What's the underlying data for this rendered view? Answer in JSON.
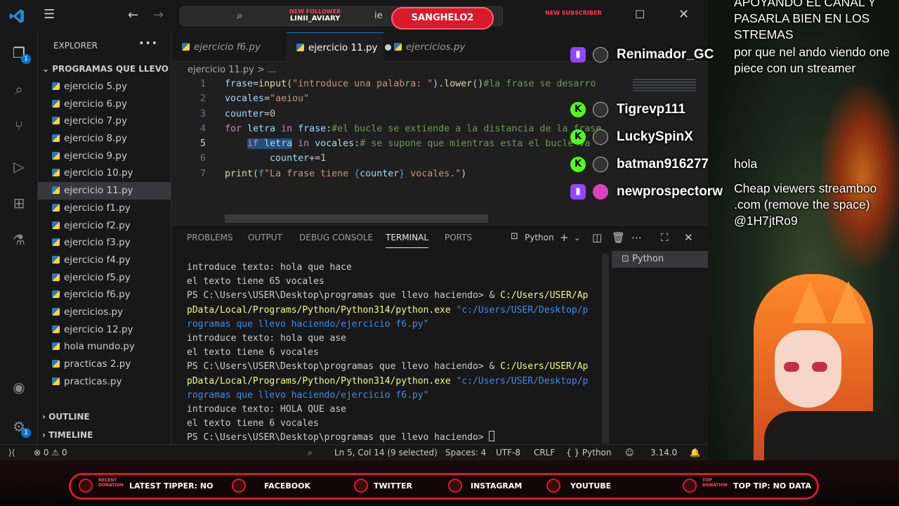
{
  "title_bar": {
    "command_center_placeholder": "",
    "overlapped_text": "ie"
  },
  "sidebar": {
    "header": "EXPLORER",
    "folder": "PROGRAMAS QUE LLEVO ...",
    "files": [
      {
        "label": "ejercicio 5.py"
      },
      {
        "label": "ejercicio 6.py"
      },
      {
        "label": "ejercicio 7.py"
      },
      {
        "label": "ejercicio 8.py"
      },
      {
        "label": "ejercicio 9.py"
      },
      {
        "label": "ejercicio 10.py"
      },
      {
        "label": "ejercicio 11.py",
        "active": true
      },
      {
        "label": "ejercicio f1.py"
      },
      {
        "label": "ejercicio f2.py"
      },
      {
        "label": "ejercicio f3.py"
      },
      {
        "label": "ejercicio f4.py"
      },
      {
        "label": "ejercicio f5.py"
      },
      {
        "label": "ejercicio f6.py"
      },
      {
        "label": "ejercicios.py"
      },
      {
        "label": "ejercicio 12.py"
      },
      {
        "label": "hola mundo.py"
      },
      {
        "label": "practicas 2.py"
      },
      {
        "label": "practicas.py"
      }
    ],
    "outline": "OUTLINE",
    "timeline": "TIMELINE"
  },
  "editor": {
    "tabs": [
      {
        "label": "ejercicio f6.py"
      },
      {
        "label": "ejercicio 11.py",
        "active": true,
        "modified": true
      },
      {
        "label": "ejercicios.py"
      }
    ],
    "breadcrumb": "ejercicio 11.py > ...",
    "line_numbers": [
      "1",
      "2",
      "3",
      "4",
      "5",
      "6",
      "7"
    ],
    "lines": [
      [
        [
          "v",
          "frase"
        ],
        [
          "p",
          "="
        ],
        [
          "f",
          "input"
        ],
        [
          "p",
          "("
        ],
        [
          "s",
          "\"introduce una palabra: \""
        ],
        [
          "p",
          ")."
        ],
        [
          "f",
          "lower"
        ],
        [
          "p",
          "()"
        ],
        [
          "c",
          "#la frase se desarro"
        ]
      ],
      [
        [
          "v",
          "vocales"
        ],
        [
          "p",
          "="
        ],
        [
          "s",
          "\"aeiou\""
        ]
      ],
      [
        [
          "v",
          "counter"
        ],
        [
          "p",
          "="
        ],
        [
          "n",
          "0"
        ]
      ],
      [
        [
          "k",
          "for"
        ],
        [
          "p",
          " "
        ],
        [
          "v",
          "letra"
        ],
        [
          "p",
          " "
        ],
        [
          "k",
          "in"
        ],
        [
          "p",
          " "
        ],
        [
          "v",
          "frase"
        ],
        [
          "p",
          ":"
        ],
        [
          "c",
          "#el bucle se extiende a la distancia de la frase"
        ]
      ],
      [
        [
          "p",
          "    "
        ],
        [
          "ksel",
          "if"
        ],
        [
          "psel",
          " "
        ],
        [
          "vsel",
          "letra"
        ],
        [
          "p",
          " "
        ],
        [
          "k",
          "in"
        ],
        [
          "p",
          " "
        ],
        [
          "v",
          "vocales"
        ],
        [
          "p",
          ":"
        ],
        [
          "c",
          "# se supone que mientras esta el bucle va"
        ]
      ],
      [
        [
          "p",
          "        "
        ],
        [
          "v",
          "counter"
        ],
        [
          "p",
          "+="
        ],
        [
          "n",
          "1"
        ]
      ],
      [
        [
          "f",
          "print"
        ],
        [
          "p",
          "("
        ],
        [
          "b",
          "f"
        ],
        [
          "s",
          "\"La frase tiene "
        ],
        [
          "b",
          "{"
        ],
        [
          "v",
          "counter"
        ],
        [
          "b",
          "}"
        ],
        [
          "s",
          " vocales.\""
        ],
        [
          "p",
          ")"
        ]
      ]
    ]
  },
  "panel": {
    "tabs": [
      "PROBLEMS",
      "OUTPUT",
      "DEBUG CONSOLE",
      "TERMINAL",
      "PORTS"
    ],
    "active_tab": "TERMINAL",
    "terminal_profile": "Python",
    "terminal_list": [
      "Python"
    ],
    "terminal_lines": [
      [
        [
          "t",
          "introduce texto: hola que hace"
        ]
      ],
      [
        [
          "t",
          "el texto tiene 65 vocales"
        ]
      ],
      [
        [
          "t",
          "PS C:\\Users\\USER\\Desktop\\programas que llevo haciendo> & "
        ],
        [
          "y",
          "C:/Users/USER/Ap"
        ]
      ],
      [
        [
          "y",
          "pData/Local/Programs/Python/Python314/python.exe"
        ],
        [
          "t",
          " "
        ],
        [
          "bl",
          "\"c:/Users/USER/Desktop/p"
        ]
      ],
      [
        [
          "bl",
          "rogramas que llevo haciendo/ejercicio f6.py\""
        ]
      ],
      [
        [
          "t",
          "introduce texto: hola que ase"
        ]
      ],
      [
        [
          "t",
          "el texto tiene 6 vocales"
        ]
      ],
      [
        [
          "t",
          "PS C:\\Users\\USER\\Desktop\\programas que llevo haciendo> & "
        ],
        [
          "y",
          "C:/Users/USER/Ap"
        ]
      ],
      [
        [
          "y",
          "pData/Local/Programs/Python/Python314/python.exe"
        ],
        [
          "t",
          " "
        ],
        [
          "bl",
          "\"c:/Users/USER/Desktop/p"
        ]
      ],
      [
        [
          "bl",
          "rogramas que llevo haciendo/ejercicio f6.py\""
        ]
      ],
      [
        [
          "t",
          "introduce texto: HOLA QUE ase"
        ]
      ],
      [
        [
          "t",
          "el texto tiene 6 vocales"
        ]
      ],
      [
        [
          "t",
          "PS C:\\Users\\USER\\Desktop\\programas que llevo haciendo> "
        ],
        [
          "cur",
          ""
        ]
      ]
    ]
  },
  "status_bar": {
    "errors": "0",
    "warnings": "0",
    "position": "Ln 5, Col 14 (9 selected)",
    "spaces": "Spaces: 4",
    "encoding": "UTF-8",
    "eol": "CRLF",
    "language": "Python",
    "version": "3.14.0"
  },
  "alerts": {
    "follower_tag": "NEW FOLLOWER",
    "follower_name": "LINII_AVIARY",
    "highlight_name": "SANGHELO2",
    "subscriber_tag": "NEW SUBSCRIBER"
  },
  "chat": {
    "top_message": "APOYANDO EL CANAL Y PASARLA BIEN EN LOS STREMAS",
    "messages": [
      {
        "platform": "twitch",
        "user": "Renimador_GC",
        "text": "por que nel ando viendo one piece con un streamer"
      },
      {
        "platform": "kick",
        "user": "Tigrevp111",
        "text": ""
      },
      {
        "platform": "kick",
        "user": "LuckySpinX",
        "text": ""
      },
      {
        "platform": "kick",
        "user": "batman916277",
        "text": "hola"
      },
      {
        "platform": "twitch",
        "user": "newprospectorw",
        "text": "Cheap viewers streamboo .com (remove the space) @1H7jtRo9"
      }
    ]
  },
  "bottom_bar": {
    "recent_label": "RECENT DONATION",
    "latest_tipper": "LATEST TIPPER: NO",
    "facebook": "FACEBOOK",
    "twitter": "TWITTER",
    "instagram": "INSTAGRAM",
    "youtube": "YOUTUBE",
    "top_label": "TOP DONATION",
    "top_tip": "TOP TIP: NO DATA"
  },
  "colors": {
    "accent": "#0078d4",
    "overlay_red": "#d81a2a",
    "twitch": "#9146ff",
    "kick": "#53fc18"
  },
  "icons": {
    "activity": [
      "explorer-icon",
      "search-icon",
      "source-control-icon",
      "run-debug-icon",
      "extensions-icon",
      "testing-icon",
      "account-icon",
      "settings-icon"
    ]
  }
}
